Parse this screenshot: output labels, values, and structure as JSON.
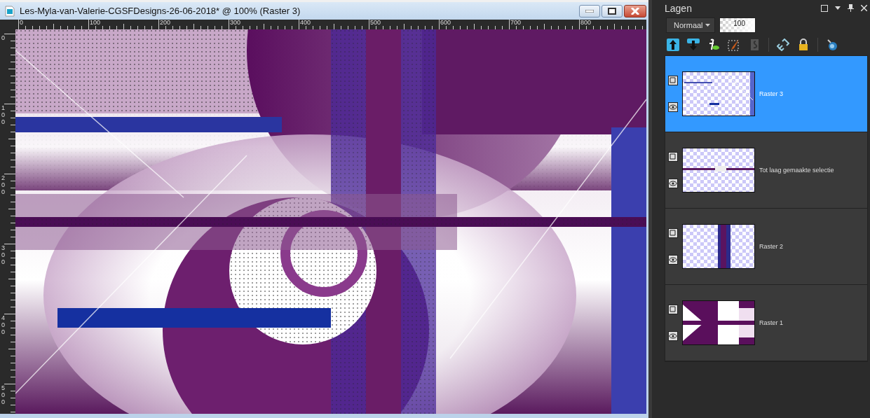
{
  "window": {
    "title": "Les-Myla-van-Valerie-CGSFDesigns-26-06-2018* @ 100% (Raster 3)"
  },
  "rulers": {
    "horizontal": [
      "0",
      "100",
      "200",
      "300",
      "400",
      "500",
      "600",
      "700",
      "800"
    ],
    "vertical": [
      "0",
      "100",
      "200",
      "300",
      "400",
      "500"
    ]
  },
  "layers_panel": {
    "title": "Lagen",
    "blend_mode": "Normaal",
    "opacity": "100",
    "layers": [
      {
        "name": "Raster 3",
        "selected": true,
        "visible": true,
        "kind": "overlay"
      },
      {
        "name": "Tot laag gemaakte selectie",
        "selected": false,
        "visible": true,
        "kind": "stripe"
      },
      {
        "name": "Raster 2",
        "selected": false,
        "visible": true,
        "kind": "band"
      },
      {
        "name": "Raster 1",
        "selected": false,
        "visible": true,
        "kind": "gradient"
      }
    ]
  }
}
